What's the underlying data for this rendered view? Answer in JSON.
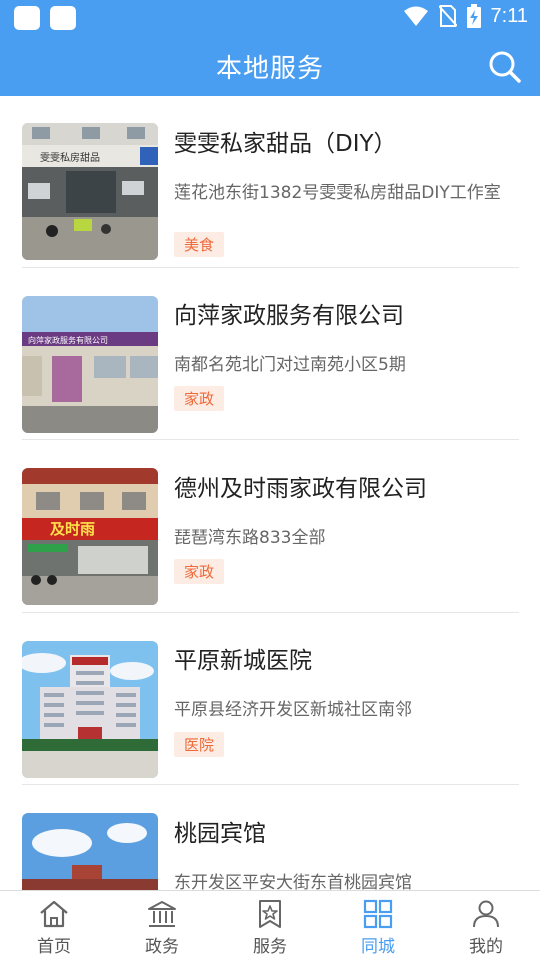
{
  "status_bar": {
    "time": "7:11"
  },
  "header": {
    "title": "本地服务"
  },
  "items": [
    {
      "title": "雯雯私家甜品（DIY）",
      "address": "莲花池东街1382号雯雯私房甜品DIY工作室",
      "tag": "美食"
    },
    {
      "title": "向萍家政服务有限公司",
      "address": "南都名苑北门对过南苑小区5期",
      "tag": "家政"
    },
    {
      "title": "德州及时雨家政有限公司",
      "address": "琵琶湾东路833全部",
      "tag": "家政"
    },
    {
      "title": "平原新城医院",
      "address": "平原县经济开发区新城社区南邻",
      "tag": "医院"
    },
    {
      "title": "桃园宾馆",
      "address": "东开发区平安大街东首桃园宾馆",
      "tag": ""
    }
  ],
  "thumb_signs": [
    "雯雯私房甜品",
    "向萍家政服务有限公司",
    "及时雨"
  ],
  "tabs": [
    {
      "label": "首页",
      "icon": "home-icon"
    },
    {
      "label": "政务",
      "icon": "government-icon"
    },
    {
      "label": "服务",
      "icon": "service-star-icon"
    },
    {
      "label": "同城",
      "icon": "grid-icon"
    },
    {
      "label": "我的",
      "icon": "person-icon"
    }
  ],
  "colors": {
    "primary": "#4a9ef1",
    "tag_text": "#ee6a3a",
    "tag_bg": "#fdece4"
  }
}
